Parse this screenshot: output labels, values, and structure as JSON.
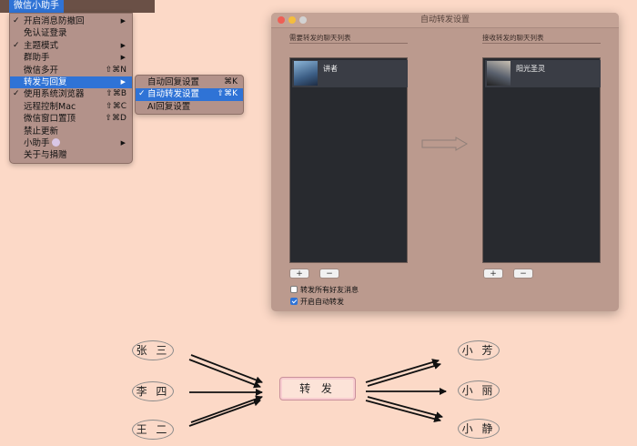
{
  "menubar": {
    "title": "微信小助手"
  },
  "menu": {
    "items": [
      {
        "label": "开启消息防撤回",
        "checked": true,
        "submenu": true,
        "shortcut": ""
      },
      {
        "label": "免认证登录",
        "checked": false,
        "submenu": false,
        "shortcut": ""
      },
      {
        "label": "主题模式",
        "checked": true,
        "submenu": true,
        "shortcut": ""
      },
      {
        "label": "群助手",
        "checked": false,
        "submenu": true,
        "shortcut": ""
      },
      {
        "label": "微信多开",
        "checked": false,
        "submenu": false,
        "shortcut": "⇧⌘N"
      },
      {
        "label": "转发与回复",
        "checked": false,
        "submenu": true,
        "shortcut": "",
        "highlighted": true
      },
      {
        "label": "使用系统浏览器",
        "checked": true,
        "submenu": false,
        "shortcut": "⇧⌘B"
      },
      {
        "label": "远程控制Mac",
        "checked": false,
        "submenu": false,
        "shortcut": "⇧⌘C"
      },
      {
        "label": "微信窗口置顶",
        "checked": false,
        "submenu": false,
        "shortcut": "⇧⌘D"
      },
      {
        "label": "禁止更新",
        "checked": false,
        "submenu": false,
        "shortcut": ""
      },
      {
        "label": "小助手",
        "checked": false,
        "submenu": true,
        "shortcut": "",
        "icon": "moon-emoji-icon"
      },
      {
        "label": "关于与捐赠",
        "checked": false,
        "submenu": false,
        "shortcut": ""
      }
    ]
  },
  "submenu": {
    "items": [
      {
        "label": "自动回复设置",
        "checked": false,
        "shortcut": "⌘K"
      },
      {
        "label": "自动转发设置",
        "checked": true,
        "shortcut": "⇧⌘K",
        "highlighted": true
      },
      {
        "label": "AI回复设置",
        "checked": false,
        "shortcut": ""
      }
    ]
  },
  "window": {
    "title": "自动转发设置",
    "left_panel": {
      "label": "需要转发的聊天列表",
      "contact": "讲者"
    },
    "right_panel": {
      "label": "接收转发的聊天列表",
      "contact": "阳光圣灵"
    },
    "add_label": "+",
    "remove_label": "−",
    "checkbox_forward_all": {
      "label": "转发所有好友消息",
      "checked": false
    },
    "checkbox_enable": {
      "label": "开启自动转发",
      "checked": true
    }
  },
  "diagram": {
    "senders": [
      "张 三",
      "李 四",
      "王 二"
    ],
    "center": "转 发",
    "receivers": [
      "小 芳",
      "小 丽",
      "小 静"
    ]
  },
  "colors": {
    "background": "#fcd9c7",
    "menu_highlight": "#2f73d6",
    "window_bg": "#bb9a8e",
    "list_bg": "#282a2f"
  }
}
